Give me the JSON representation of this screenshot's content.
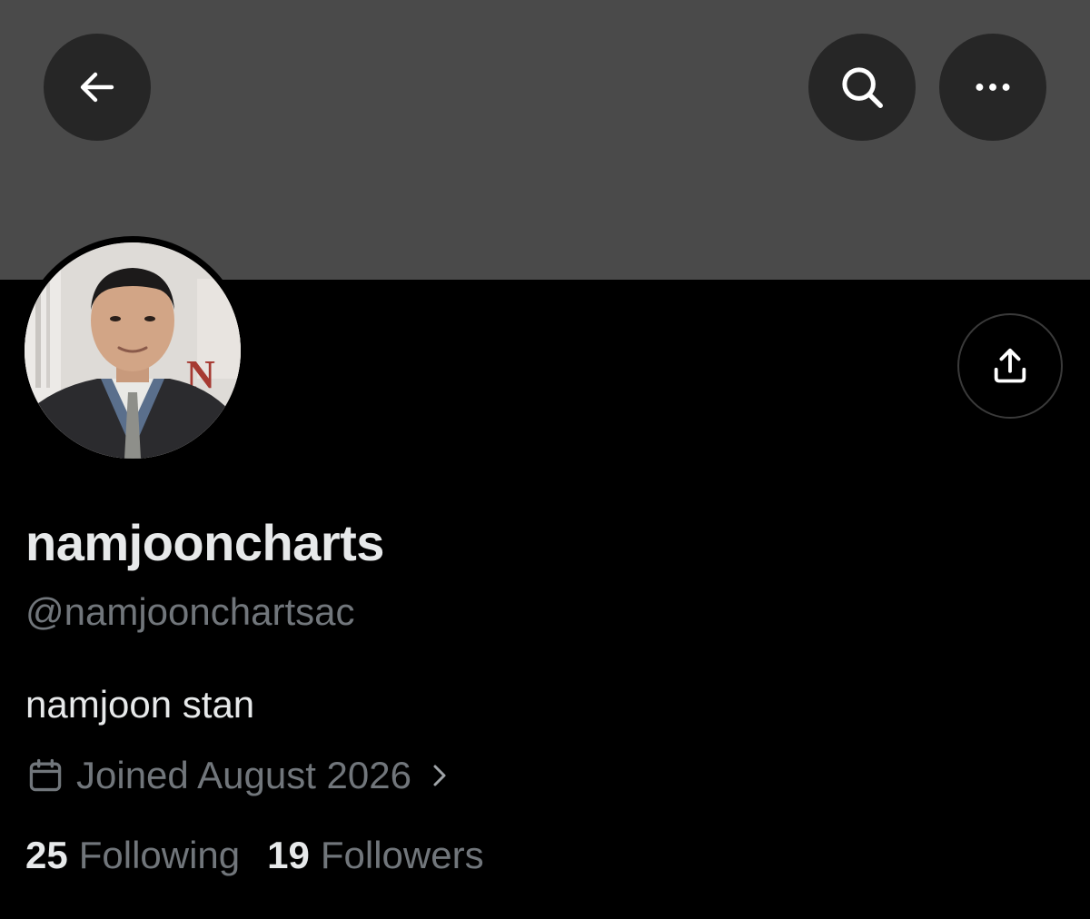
{
  "header": {
    "back_icon": "arrow-left-icon",
    "search_icon": "search-icon",
    "more_icon": "more-horizontal-icon"
  },
  "colors": {
    "banner": "#4a4a4a",
    "button_bg": "#262626",
    "text_primary": "#e7e9ea",
    "text_secondary": "#71767b",
    "background": "#000000"
  },
  "profile": {
    "display_name": "namjooncharts",
    "handle": "@namjoonchartsac",
    "bio": "namjoon stan",
    "joined": "Joined August 2026",
    "joined_icon": "calendar-icon",
    "share_icon": "share-upload-icon",
    "following_count": "25",
    "following_label": "Following",
    "followers_count": "19",
    "followers_label": "Followers"
  }
}
